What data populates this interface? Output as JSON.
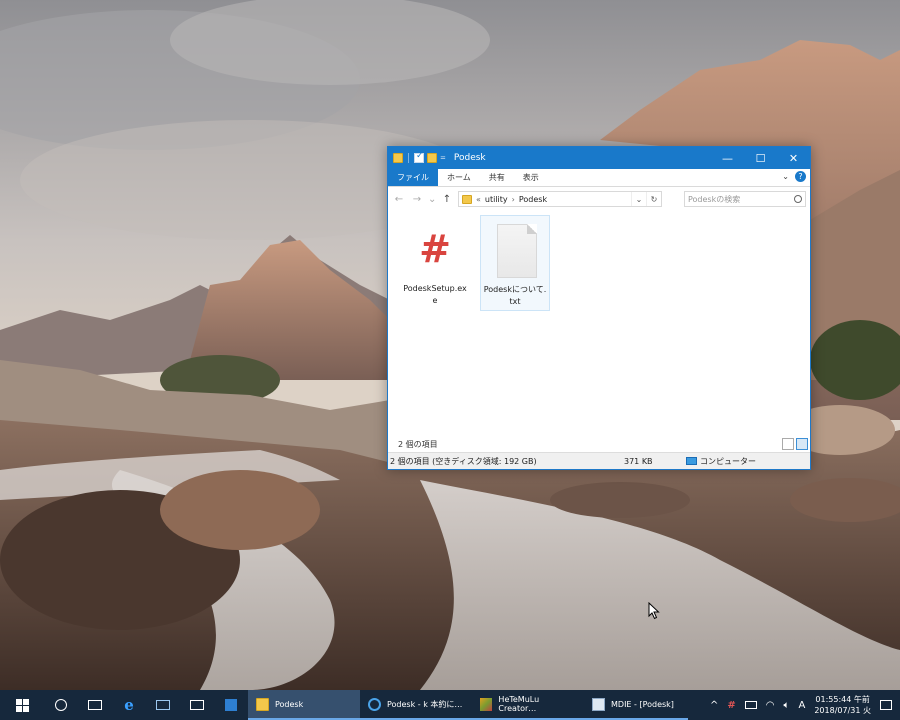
{
  "window": {
    "title": "Podesk",
    "quick_access_dropdown": "=",
    "controls": {
      "minimize": "—",
      "maximize": "☐",
      "close": "✕"
    }
  },
  "ribbon": {
    "tabs": [
      {
        "label": "ファイル",
        "active": true
      },
      {
        "label": "ホーム"
      },
      {
        "label": "共有"
      },
      {
        "label": "表示"
      }
    ],
    "expand_icon": "chevron-down-icon",
    "help": "?"
  },
  "navigation": {
    "back": "←",
    "forward": "→",
    "recent": "⌄",
    "up": "↑",
    "address": {
      "overflow": "«",
      "segments": [
        "utility",
        "Podesk"
      ]
    },
    "address_dropdown": "⌄",
    "refresh": "↻",
    "search_placeholder": "Podeskの検索"
  },
  "files": [
    {
      "name": "PodeskSetup.exe",
      "icon": "hash-icon",
      "selected": false
    },
    {
      "name": "Podeskについて.txt",
      "icon": "text-document-icon",
      "selected": true
    }
  ],
  "status": {
    "item_count": "2 個の項目",
    "details_left": "2 個の項目 (空きディスク領域: 192 GB)",
    "details_size": "371 KB",
    "details_location": "コンピューター"
  },
  "taskbar": {
    "tasks": [
      {
        "label": "Podesk",
        "icon": "folder-icon",
        "active": true
      },
      {
        "label": "Podesk - k 本約に…",
        "icon": "podesk-app-icon"
      },
      {
        "label": "HeTeMuLu Creator…",
        "icon": "hetemulu-icon"
      },
      {
        "label": "MDIE - [Podesk]",
        "icon": "mdie-icon"
      }
    ],
    "tray": {
      "chevron": "^",
      "ime": "A",
      "time": "01:55:44 午前",
      "date": "2018/07/31 火"
    }
  },
  "colors": {
    "accent": "#1979ca",
    "taskbar": "#16283c",
    "hash": "#d9443f"
  }
}
